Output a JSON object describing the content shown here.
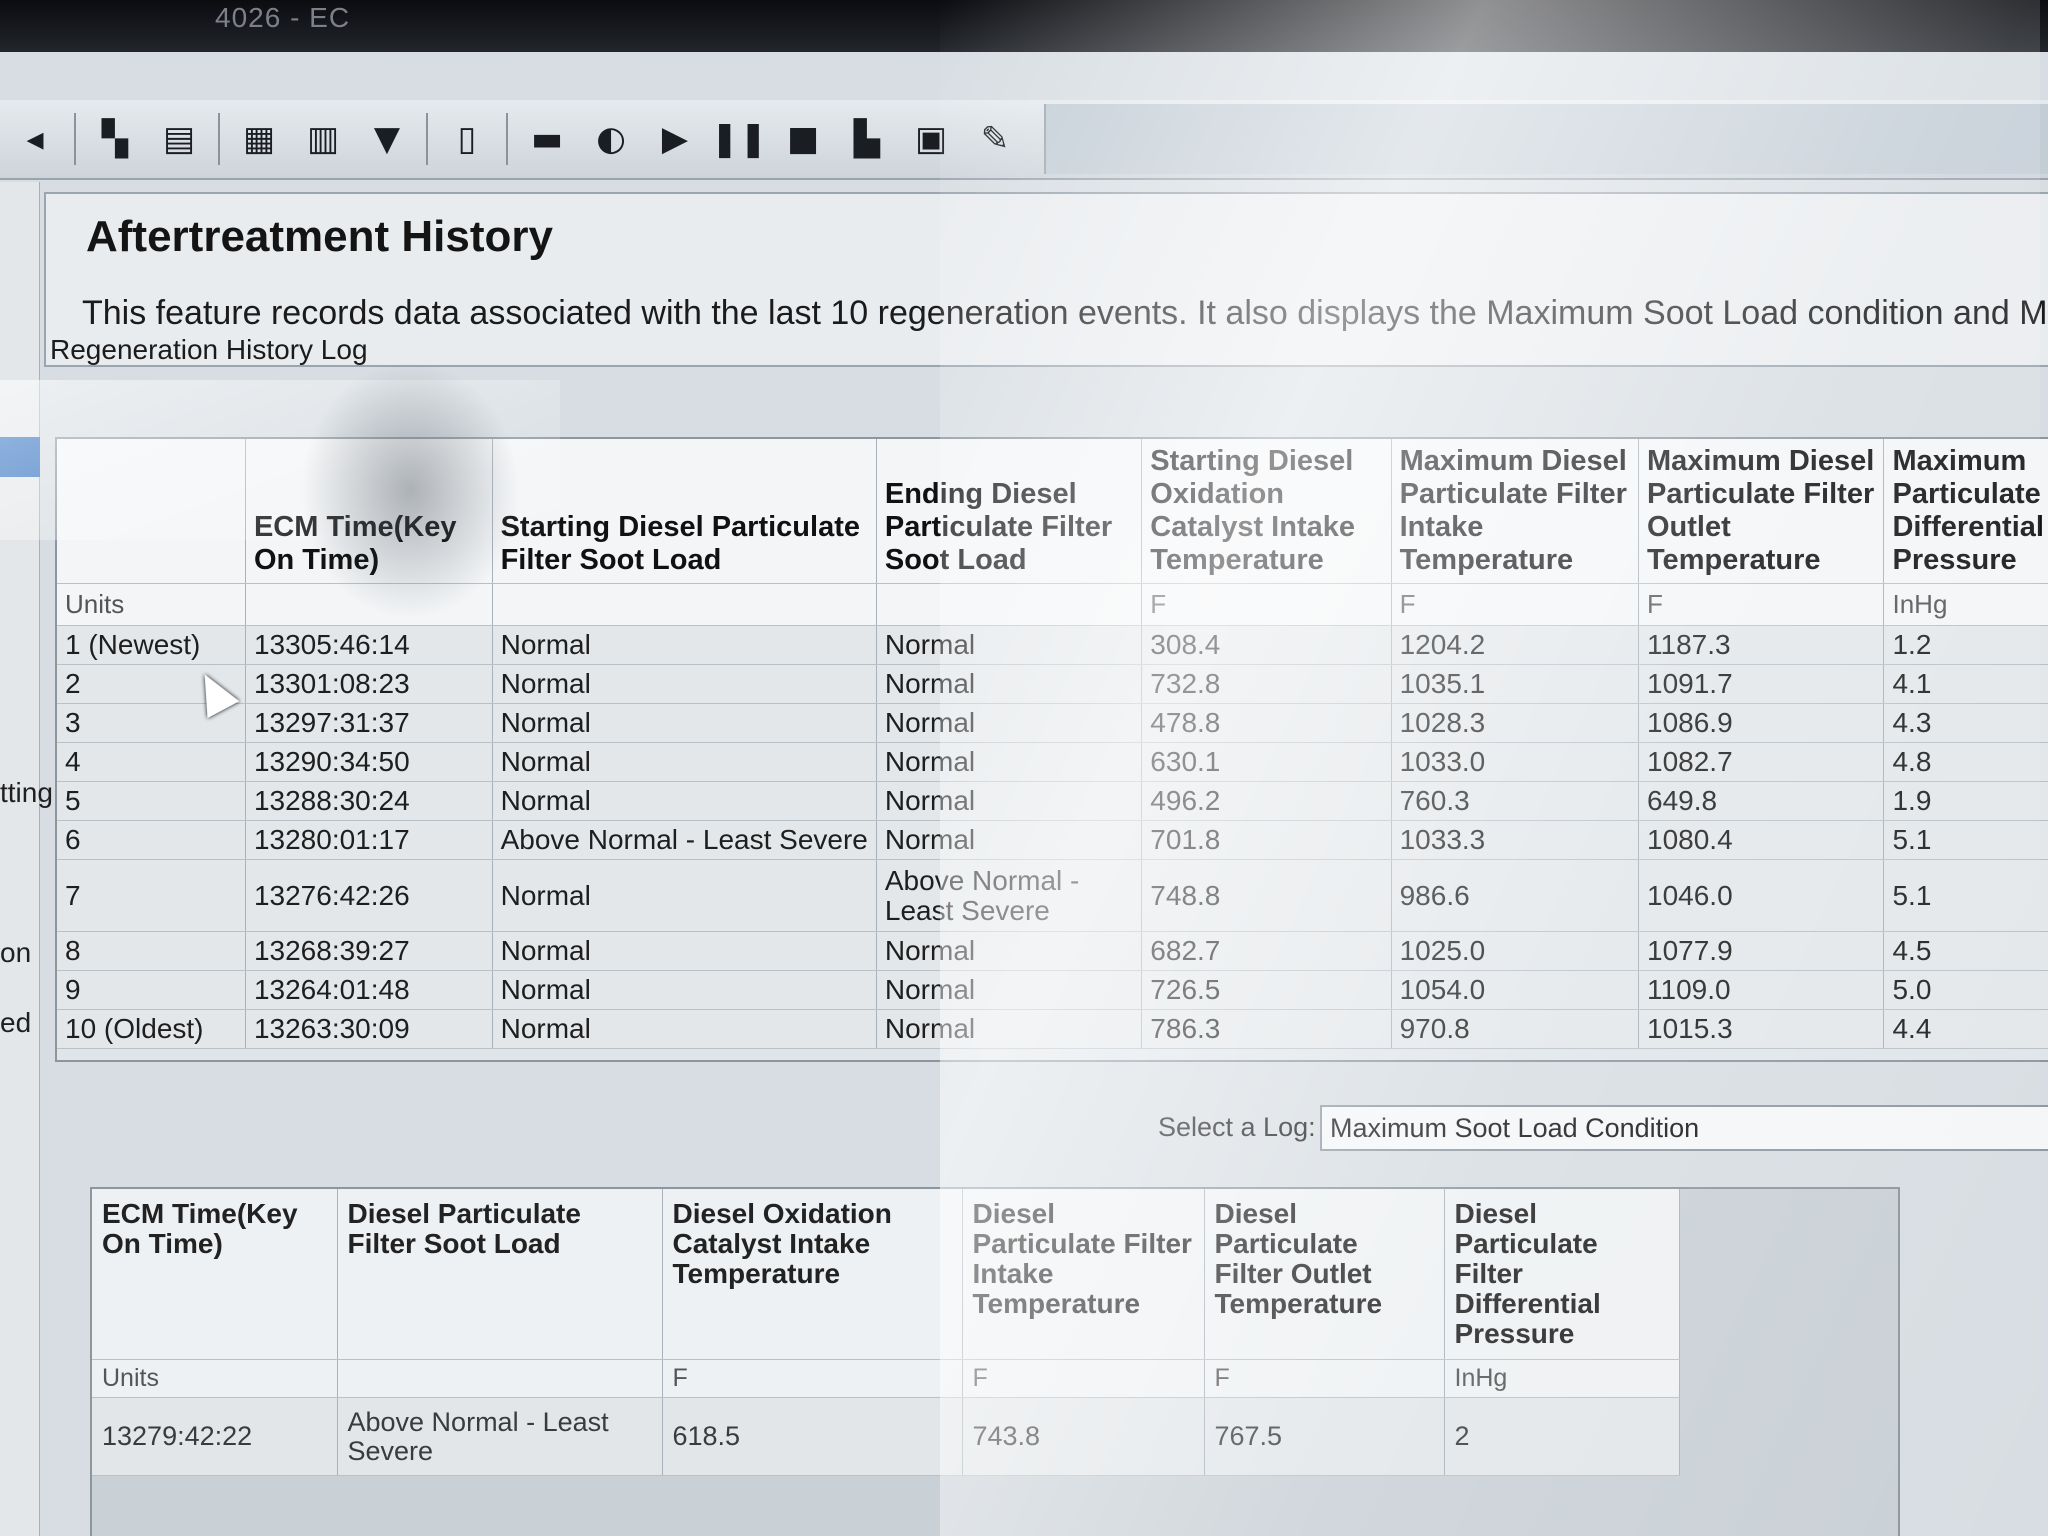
{
  "window": {
    "title": "4026 - EC"
  },
  "toolbar": {
    "buttons": [
      {
        "name": "back-icon",
        "glyph": "◂"
      },
      {
        "name": "connect-icon",
        "glyph": "▚"
      },
      {
        "name": "print-icon",
        "glyph": "▤"
      },
      {
        "name": "report-icon",
        "glyph": "▦"
      },
      {
        "name": "save-icon",
        "glyph": "▥"
      },
      {
        "name": "filter-icon",
        "glyph": "▼"
      },
      {
        "name": "clipboard-icon",
        "glyph": "▯"
      },
      {
        "name": "record-icon",
        "glyph": "▬"
      },
      {
        "name": "step-icon",
        "glyph": "◐"
      },
      {
        "name": "play-icon",
        "glyph": "▶"
      },
      {
        "name": "pause-icon",
        "glyph": "❚❚"
      },
      {
        "name": "stop-icon",
        "glyph": "■"
      },
      {
        "name": "download-icon",
        "glyph": "▙"
      },
      {
        "name": "calc-icon",
        "glyph": "▣"
      },
      {
        "name": "edit-icon",
        "glyph": "✎"
      }
    ]
  },
  "left_labels": [
    "tting",
    "on",
    "ed"
  ],
  "header": {
    "title": "Aftertreatment History",
    "description": "This feature records data associated with the last 10 regeneration events. It also displays the Maximum Soot Load condition and Ma"
  },
  "main_grid": {
    "section_label": "Regeneration History Log",
    "columns": [
      "",
      "ECM Time(Key On Time)",
      "Starting Diesel Particulate Filter Soot Load",
      "Ending Diesel Particulate Filter Soot Load",
      "Starting Diesel Oxidation Catalyst Intake Temperature",
      "Maximum Diesel Particulate Filter Intake Temperature",
      "Maximum Diesel Particulate Filter Outlet Temperature",
      "Maximum Particulate Differential Pressure"
    ],
    "units": [
      "Units",
      "",
      "",
      "",
      "F",
      "F",
      "F",
      "InHg"
    ],
    "rows": [
      [
        "1 (Newest)",
        "13305:46:14",
        "Normal",
        "Normal",
        "308.4",
        "1204.2",
        "1187.3",
        "1.2"
      ],
      [
        "2",
        "13301:08:23",
        "Normal",
        "Normal",
        "732.8",
        "1035.1",
        "1091.7",
        "4.1"
      ],
      [
        "3",
        "13297:31:37",
        "Normal",
        "Normal",
        "478.8",
        "1028.3",
        "1086.9",
        "4.3"
      ],
      [
        "4",
        "13290:34:50",
        "Normal",
        "Normal",
        "630.1",
        "1033.0",
        "1082.7",
        "4.8"
      ],
      [
        "5",
        "13288:30:24",
        "Normal",
        "Normal",
        "496.2",
        "760.3",
        "649.8",
        "1.9"
      ],
      [
        "6",
        "13280:01:17",
        "Above Normal - Least Severe",
        "Normal",
        "701.8",
        "1033.3",
        "1080.4",
        "5.1"
      ],
      [
        "7",
        "13276:42:26",
        "Normal",
        "Above Normal - Least Severe",
        "748.8",
        "986.6",
        "1046.0",
        "5.1"
      ],
      [
        "8",
        "13268:39:27",
        "Normal",
        "Normal",
        "682.7",
        "1025.0",
        "1077.9",
        "4.5"
      ],
      [
        "9",
        "13264:01:48",
        "Normal",
        "Normal",
        "726.5",
        "1054.0",
        "1109.0",
        "5.0"
      ],
      [
        "10 (Oldest)",
        "13263:30:09",
        "Normal",
        "Normal",
        "786.3",
        "970.8",
        "1015.3",
        "4.4"
      ]
    ]
  },
  "select_log": {
    "label": "Select a Log:",
    "value": "Maximum Soot Load Condition"
  },
  "lower_grid": {
    "columns": [
      "ECM Time(Key On Time)",
      "Diesel Particulate Filter Soot Load",
      "Diesel Oxidation Catalyst Intake Temperature",
      "Diesel Particulate Filter Intake Temperature",
      "Diesel Particulate Filter Outlet Temperature",
      "Diesel Particulate Filter Differential Pressure"
    ],
    "units": [
      "Units",
      "",
      "F",
      "F",
      "F",
      "InHg"
    ],
    "rows": [
      [
        "13279:42:22",
        "Above Normal - Least Severe",
        "618.5",
        "743.8",
        "767.5",
        "2"
      ]
    ]
  }
}
